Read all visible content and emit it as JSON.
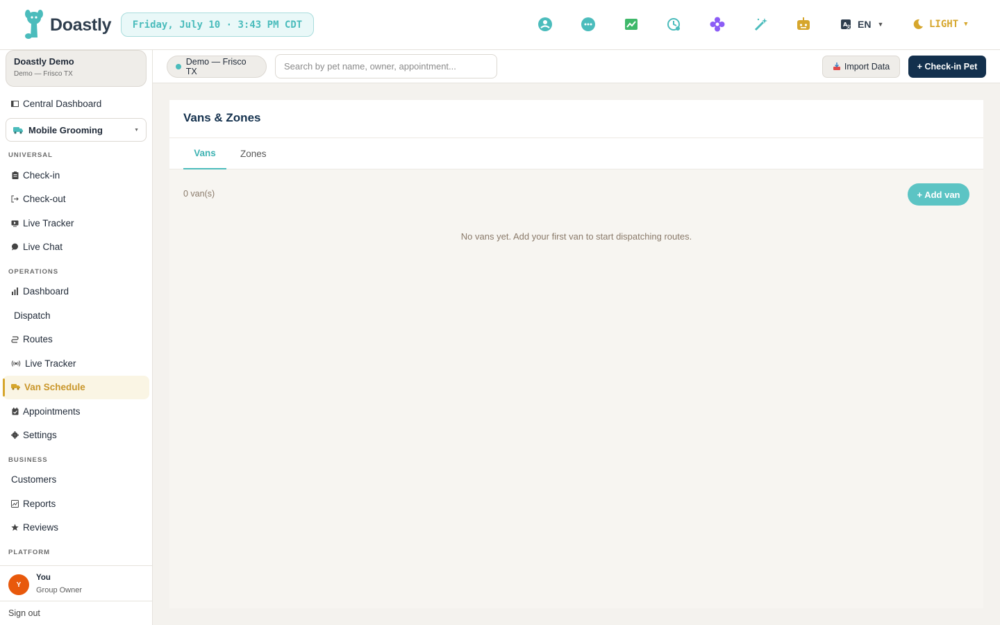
{
  "app": {
    "name": "Doastly",
    "datetime": "Friday, July 10 · 3:43 PM CDT"
  },
  "topbar": {
    "icons": [
      "users-icon",
      "chat-icon",
      "chart-icon",
      "clock-icon",
      "flower-icon",
      "magic-wand-icon",
      "robot-icon"
    ],
    "language": "EN",
    "theme": "LIGHT"
  },
  "sidebar": {
    "org_name": "Doastly Demo",
    "org_sub": "Demo — Frisco TX",
    "central_dashboard": "Central Dashboard",
    "business_type": "Mobile Grooming",
    "sections": {
      "universal": "UNIVERSAL",
      "operations": "OPERATIONS",
      "business": "BUSINESS",
      "platform": "PLATFORM"
    },
    "universal_items": [
      "Check-in",
      "Check-out",
      "Live Tracker",
      "Live Chat"
    ],
    "operations_items": [
      "Dashboard",
      "Dispatch",
      "Routes",
      "Live Tracker",
      "Van Schedule",
      "Appointments",
      "Settings"
    ],
    "business_items": [
      "Customers",
      "Reports",
      "Reviews"
    ],
    "active_item": "Van Schedule",
    "user": {
      "initial": "Y",
      "name": "You",
      "role": "Group Owner"
    },
    "sign_out": "Sign out"
  },
  "subbar": {
    "location": "Demo — Frisco TX",
    "search_placeholder": "Search by pet name, owner, appointment...",
    "import_label": "Import Data",
    "checkin_label": "+ Check-in Pet"
  },
  "main": {
    "title": "Vans & Zones",
    "tabs": [
      "Vans",
      "Zones"
    ],
    "active_tab": "Vans",
    "count_text": "0 van(s)",
    "add_button": "+ Add van",
    "empty_text": "No vans yet. Add your first van to start dispatching routes."
  },
  "colors": {
    "accent_teal": "#4bbcbc",
    "accent_gold": "#d6a62c",
    "navy": "#13304d",
    "avatar_orange": "#e8590c"
  }
}
